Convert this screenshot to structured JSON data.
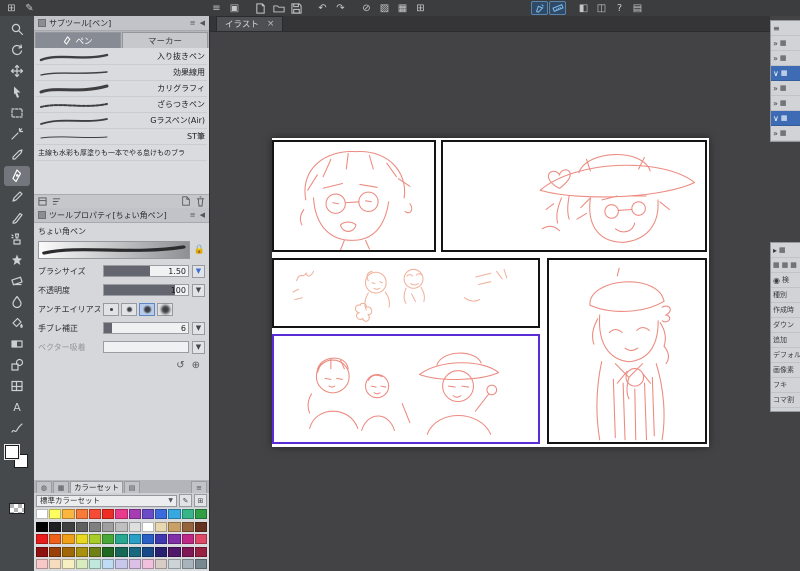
{
  "theme": {
    "sketch-color": "#ec8b80",
    "sketch-light": "#f0b19b",
    "selected-frame": "#5b2bd5",
    "accent-blue": "#7db8ea"
  },
  "topbar": {
    "app_grid": "⊞",
    "app_pen": "✎",
    "menu": "≡",
    "clipstudio": "▣",
    "undo": "↶",
    "redo": "↷",
    "clear": "⊘",
    "fill": "▨",
    "grid": "▦",
    "grid2": "⊞",
    "bubble": "◧",
    "window": "◫",
    "help": "?",
    "layout": "▤"
  },
  "panels_ui": {
    "collapse": "◀",
    "menu": "≡",
    "arrow_down": "▾"
  },
  "subtool": {
    "title": "サブツール[ペン]",
    "tab_pen": "ペン",
    "tab_marker": "マーカー",
    "items": [
      "入り抜きペン",
      "効果線用",
      "カリグラフィ",
      "ざらつきペン",
      "Gラスペン(Air)",
      "ST筆",
      "主線も水彩も厚塗りも一本でやる怠けものブラ"
    ]
  },
  "toolprop": {
    "title": "ツールプロパティ[ちょい角ペン]",
    "brush_name": "ちょい角ペン",
    "brush_size_label": "ブラシサイズ",
    "brush_size_value": "1.50",
    "opacity_label": "不透明度",
    "opacity_value": "100",
    "antialias_label": "アンチエイリアス",
    "stabilize_label": "手ブレ補正",
    "stabilize_value": "6",
    "vector_snap_label": "ベクター吸着",
    "footer_reset": "↺",
    "footer_zoom": "⊕",
    "dropdown_arrow": "▼"
  },
  "colorset": {
    "tab_label": "カラーセット",
    "dropdown": "標準カラーセット",
    "dropdown_arrow": "▼",
    "icons": {
      "wheel": "◍",
      "grid": "▦",
      "set": "▩",
      "mix": "▤",
      "menu": "≡",
      "add": "⊞",
      "edit": "✎"
    },
    "colors": [
      [
        "#ffffff",
        "#fdfd60",
        "#fcb640",
        "#f87c38",
        "#f84b36",
        "#ee2e24",
        "#ea3a8c",
        "#a53cb4",
        "#6a4cc8",
        "#3b6bdc",
        "#38a8e0",
        "#38b48b",
        "#2f9e44"
      ],
      [
        "#000000",
        "#202020",
        "#404040",
        "#606060",
        "#808080",
        "#9f9f9f",
        "#bfbfbf",
        "#dfdfdf",
        "#ffffff",
        "#e8d8b0",
        "#c8a068",
        "#96643c",
        "#64321e"
      ],
      [
        "#e81c1c",
        "#f06018",
        "#f0a018",
        "#e8d820",
        "#a8cc28",
        "#48a838",
        "#28a890",
        "#28a0c8",
        "#2860c8",
        "#4038b0",
        "#8030a8",
        "#c02888",
        "#e04868"
      ],
      [
        "#901010",
        "#984008",
        "#a06808",
        "#a89010",
        "#708018",
        "#206820",
        "#186858",
        "#186880",
        "#184888",
        "#282070",
        "#501868",
        "#801858",
        "#982040"
      ],
      [
        "#f8c8c8",
        "#f8dcc0",
        "#f8f0c0",
        "#d8ecc0",
        "#c0e8dc",
        "#c0dcf4",
        "#c8c8ec",
        "#dcc0e8",
        "#f0c0dc",
        "#d8ccc4",
        "#ccd4d8",
        "#a8b4bc",
        "#788890"
      ]
    ]
  },
  "canvas": {
    "doc_tab": "イラスト",
    "close": "×"
  },
  "right_panel": {
    "menu": "≡",
    "collapse": "»",
    "expand": "∨",
    "item": "▸",
    "box": "▦",
    "search_icon": "◉",
    "search": "検",
    "categories": [
      "種別",
      "作成時",
      "ダウン",
      "追加",
      "デフォル",
      "画像素",
      "フキ",
      "コマ割"
    ]
  },
  "tools": [
    "zoom",
    "rotate-canvas",
    "move",
    "operation",
    "select-area",
    "auto-select",
    "eyedropper",
    "pen",
    "pencil",
    "brush",
    "airbrush",
    "decoration",
    "eraser",
    "blend",
    "fill",
    "gradient",
    "figure",
    "frame",
    "text",
    "line-correct"
  ]
}
